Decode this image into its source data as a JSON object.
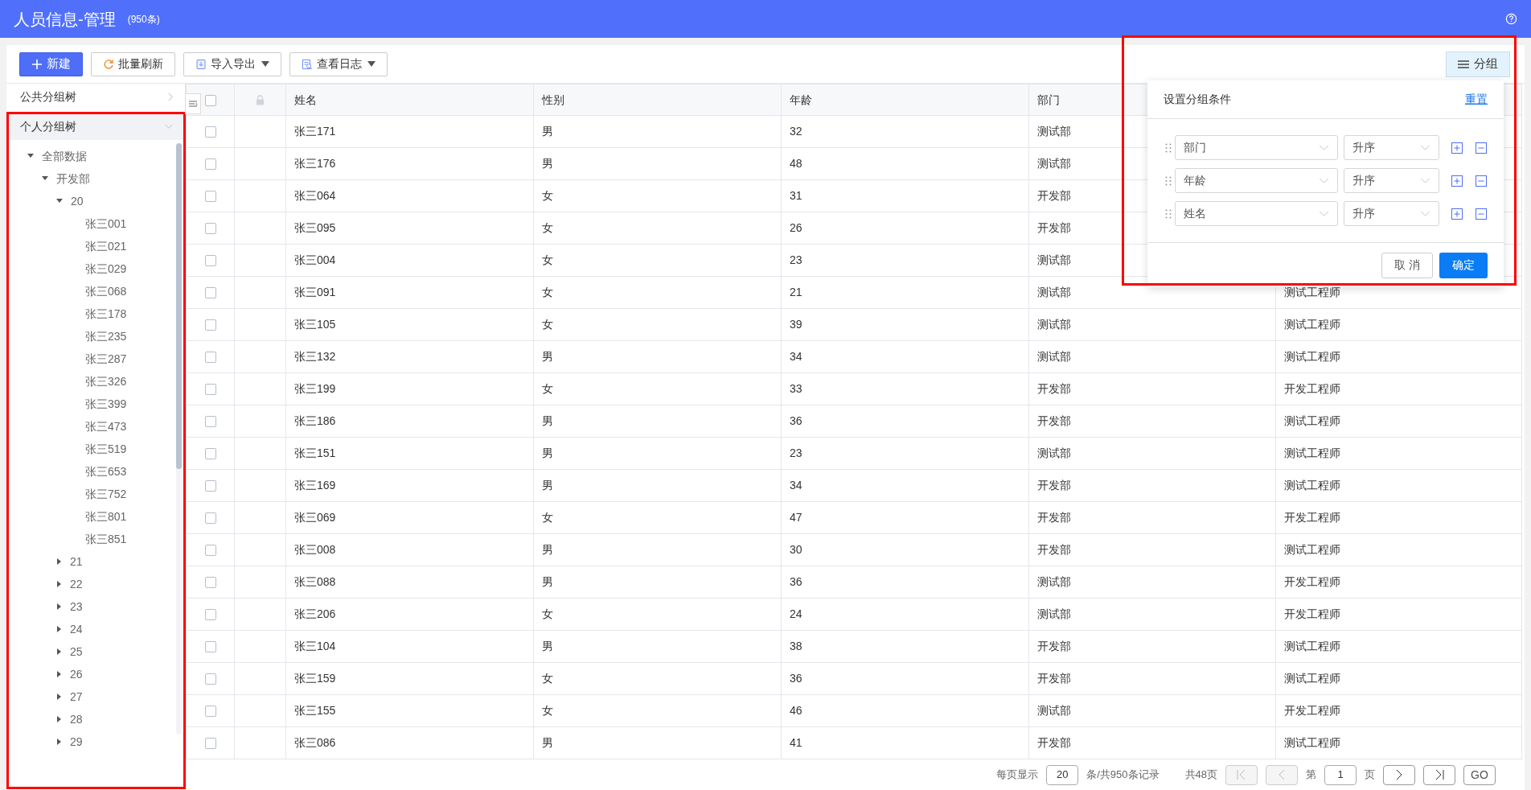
{
  "header": {
    "title": "人员信息-管理",
    "count": "(950条)"
  },
  "toolbar": {
    "buttons": [
      {
        "kind": "primary",
        "label": "新建"
      },
      {
        "kind": "plain",
        "label": "批量刷新"
      },
      {
        "kind": "dropdown",
        "label": "导入导出"
      },
      {
        "kind": "dropdown",
        "label": "查看日志"
      }
    ],
    "group_button": {
      "label": "分组",
      "active": true
    }
  },
  "sidebar": {
    "public_tree": {
      "label": "公共分组树",
      "expanded": false
    },
    "personal_tree": {
      "label": "个人分组树",
      "expanded": true,
      "highlighted": true,
      "nodes": [
        {
          "label": "全部数据",
          "expanded": true,
          "children": [
            {
              "label": "开发部",
              "expanded": true,
              "children": [
                {
                  "label": "20",
                  "expanded": true,
                  "children": [
                    {
                      "label": "张三001"
                    },
                    {
                      "label": "张三021"
                    },
                    {
                      "label": "张三029"
                    },
                    {
                      "label": "张三068"
                    },
                    {
                      "label": "张三178"
                    },
                    {
                      "label": "张三235"
                    },
                    {
                      "label": "张三287"
                    },
                    {
                      "label": "张三326"
                    },
                    {
                      "label": "张三399"
                    },
                    {
                      "label": "张三473"
                    },
                    {
                      "label": "张三519"
                    },
                    {
                      "label": "张三653"
                    },
                    {
                      "label": "张三752"
                    },
                    {
                      "label": "张三801"
                    },
                    {
                      "label": "张三851"
                    }
                  ]
                },
                {
                  "label": "21",
                  "expanded": false
                },
                {
                  "label": "22",
                  "expanded": false
                },
                {
                  "label": "23",
                  "expanded": false
                },
                {
                  "label": "24",
                  "expanded": false
                },
                {
                  "label": "25",
                  "expanded": false
                },
                {
                  "label": "26",
                  "expanded": false
                },
                {
                  "label": "27",
                  "expanded": false
                },
                {
                  "label": "28",
                  "expanded": false
                },
                {
                  "label": "29",
                  "expanded": false
                }
              ]
            }
          ]
        }
      ]
    }
  },
  "table": {
    "all_checked": false,
    "columns": [
      "姓名",
      "性别",
      "年龄",
      "部门"
    ],
    "rows": [
      {
        "checked": false,
        "cells": [
          "张三171",
          "男",
          "32",
          "测试部"
        ]
      },
      {
        "checked": false,
        "cells": [
          "张三176",
          "男",
          "48",
          "测试部"
        ]
      },
      {
        "checked": false,
        "cells": [
          "张三064",
          "女",
          "31",
          "开发部"
        ]
      },
      {
        "checked": false,
        "cells": [
          "张三095",
          "女",
          "26",
          "开发部"
        ]
      },
      {
        "checked": false,
        "cells": [
          "张三004",
          "女",
          "23",
          "测试部"
        ]
      },
      {
        "checked": false,
        "cells": [
          "张三091",
          "女",
          "21",
          "测试部",
          "测试工程师"
        ]
      },
      {
        "checked": false,
        "cells": [
          "张三105",
          "女",
          "39",
          "测试部",
          "测试工程师"
        ]
      },
      {
        "checked": false,
        "cells": [
          "张三132",
          "男",
          "34",
          "测试部",
          "测试工程师"
        ]
      },
      {
        "checked": false,
        "cells": [
          "张三199",
          "女",
          "33",
          "开发部",
          "开发工程师"
        ]
      },
      {
        "checked": false,
        "cells": [
          "张三186",
          "男",
          "36",
          "开发部",
          "测试工程师"
        ]
      },
      {
        "checked": false,
        "cells": [
          "张三151",
          "男",
          "23",
          "测试部",
          "测试工程师"
        ]
      },
      {
        "checked": false,
        "cells": [
          "张三169",
          "男",
          "34",
          "开发部",
          "测试工程师"
        ]
      },
      {
        "checked": false,
        "cells": [
          "张三069",
          "女",
          "47",
          "开发部",
          "开发工程师"
        ]
      },
      {
        "checked": false,
        "cells": [
          "张三008",
          "男",
          "30",
          "开发部",
          "测试工程师"
        ]
      },
      {
        "checked": false,
        "cells": [
          "张三088",
          "男",
          "36",
          "测试部",
          "开发工程师"
        ]
      },
      {
        "checked": false,
        "cells": [
          "张三206",
          "女",
          "24",
          "测试部",
          "开发工程师"
        ]
      },
      {
        "checked": false,
        "cells": [
          "张三104",
          "男",
          "38",
          "开发部",
          "测试工程师"
        ]
      },
      {
        "checked": false,
        "cells": [
          "张三159",
          "女",
          "36",
          "开发部",
          "测试工程师"
        ]
      },
      {
        "checked": false,
        "cells": [
          "张三155",
          "女",
          "46",
          "测试部",
          "开发工程师"
        ]
      },
      {
        "checked": false,
        "cells": [
          "张三086",
          "男",
          "41",
          "开发部",
          "测试工程师"
        ]
      }
    ]
  },
  "pagination": {
    "per_page_label": "每页显示",
    "per_page": "20",
    "total_label": "条/共950条记录",
    "pages_label": "共48页",
    "page_prefix": "第",
    "page": "1",
    "page_suffix": "页",
    "go": "GO",
    "nav": [
      {
        "kind": "first",
        "disabled": true
      },
      {
        "kind": "prev",
        "disabled": true
      },
      {
        "kind": "next",
        "disabled": false
      },
      {
        "kind": "last",
        "disabled": false
      }
    ]
  },
  "group_popup": {
    "title": "设置分组条件",
    "reset": "重置",
    "highlighted": true,
    "conditions": [
      {
        "field": "部门",
        "order": "升序"
      },
      {
        "field": "年龄",
        "order": "升序"
      },
      {
        "field": "姓名",
        "order": "升序"
      }
    ],
    "cancel": "取 消",
    "confirm": "确定"
  }
}
